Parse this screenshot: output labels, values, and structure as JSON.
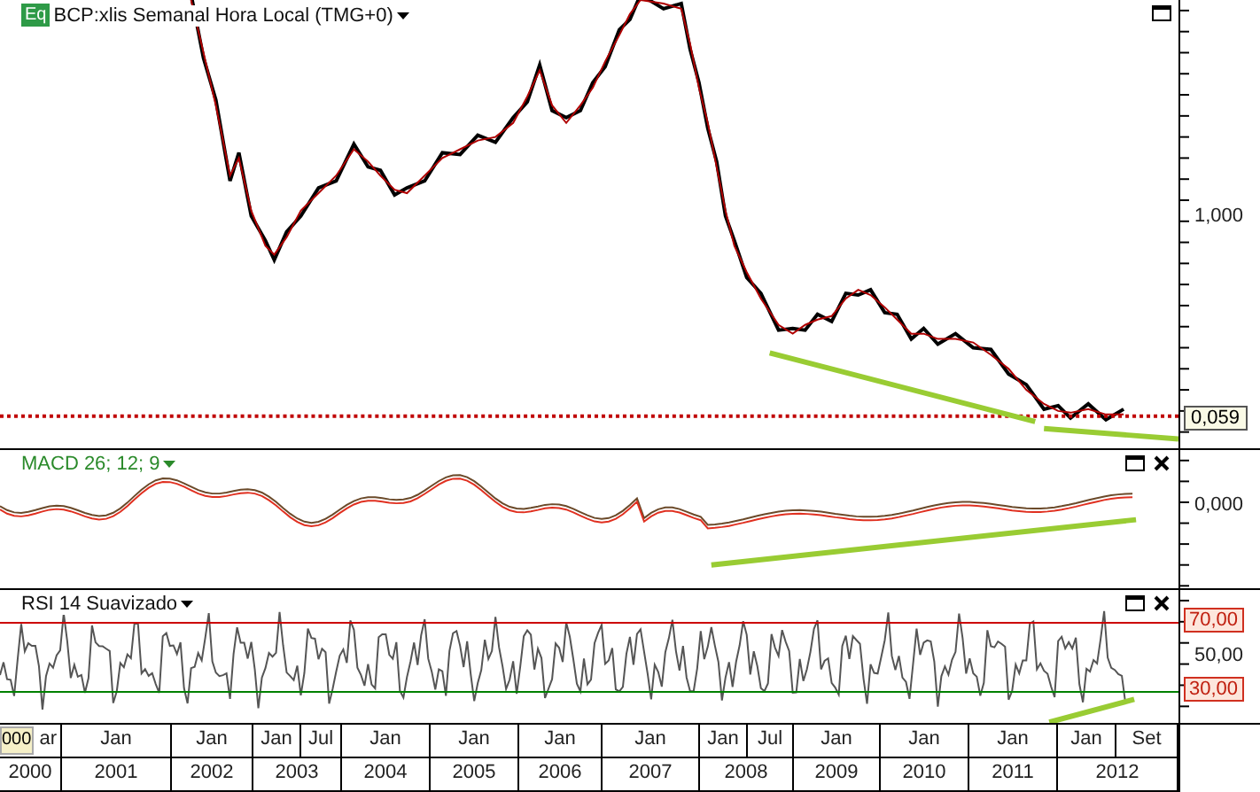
{
  "main_panel": {
    "badge": "Eq",
    "title": "BCP:xlis Semanal Hora Local (TMG+0)",
    "y_axis_labels": [
      "1,000"
    ],
    "price_tag": "0,059"
  },
  "macd_panel": {
    "title": "MACD 26; 12; 9",
    "y_axis_labels": [
      "0,000"
    ]
  },
  "rsi_panel": {
    "title": "RSI 14 Suavizado",
    "y_axis_labels": [
      "50,00"
    ],
    "levels": [
      {
        "label": "70,00",
        "color": "#cc0000"
      },
      {
        "label": "30,00",
        "color": "#008000"
      }
    ]
  },
  "x_axis": {
    "cursor_label": "000",
    "years": [
      {
        "label": "2000",
        "months": [
          "ar"
        ]
      },
      {
        "label": "2001",
        "months": [
          "Jan"
        ]
      },
      {
        "label": "2002",
        "months": [
          "Jan"
        ]
      },
      {
        "label": "2003",
        "months": [
          "Jan",
          "Jul"
        ]
      },
      {
        "label": "2004",
        "months": [
          "Jan"
        ]
      },
      {
        "label": "2005",
        "months": [
          "Jan"
        ]
      },
      {
        "label": "2006",
        "months": [
          "Jan"
        ]
      },
      {
        "label": "2007",
        "months": [
          "Jan"
        ]
      },
      {
        "label": "2008",
        "months": [
          "Jan",
          "Jul"
        ]
      },
      {
        "label": "2009",
        "months": [
          "Jan"
        ]
      },
      {
        "label": "2010",
        "months": [
          "Jan"
        ]
      },
      {
        "label": "2011",
        "months": [
          "Jan"
        ]
      },
      {
        "label": "2012",
        "months": [
          "Jan",
          "Set"
        ]
      }
    ]
  }
}
